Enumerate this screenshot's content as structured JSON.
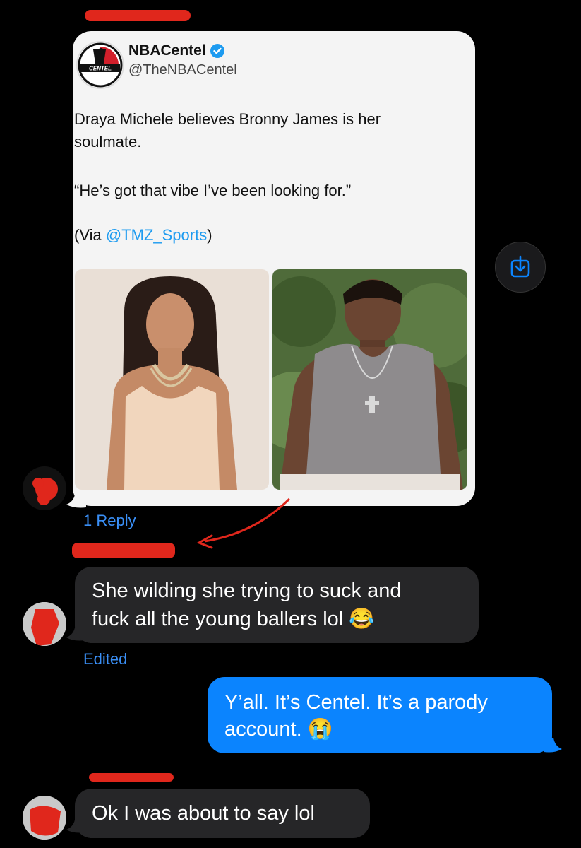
{
  "tweet": {
    "account_name": "NBACentel",
    "handle": "@TheNBACentel",
    "logo_text": "CENTEL",
    "body_line1": "Draya Michele believes Bronny James is her",
    "body_line2": "soulmate.",
    "quote": "“He’s got that vibe I’ve been looking for.”",
    "via_prefix": "(Via ",
    "via_mention": "@TMZ_Sports",
    "via_suffix": ")"
  },
  "thread": {
    "reply_count": "1 Reply",
    "edited_label": "Edited"
  },
  "messages": [
    {
      "sender": "other",
      "line1": "She wilding she trying to suck and",
      "line2": "fuck all the young ballers lol",
      "emoji": "😂"
    },
    {
      "sender": "me",
      "line1": "Y’all. It’s Centel. It’s a parody",
      "line2": "account.",
      "emoji": "😭"
    },
    {
      "sender": "other",
      "line1": "Ok I was about to say lol"
    }
  ],
  "colors": {
    "imessage_blue": "#0b84fe",
    "incoming_gray": "#262628",
    "link_blue": "#3a8ff6",
    "redaction_red": "#e0271c"
  }
}
